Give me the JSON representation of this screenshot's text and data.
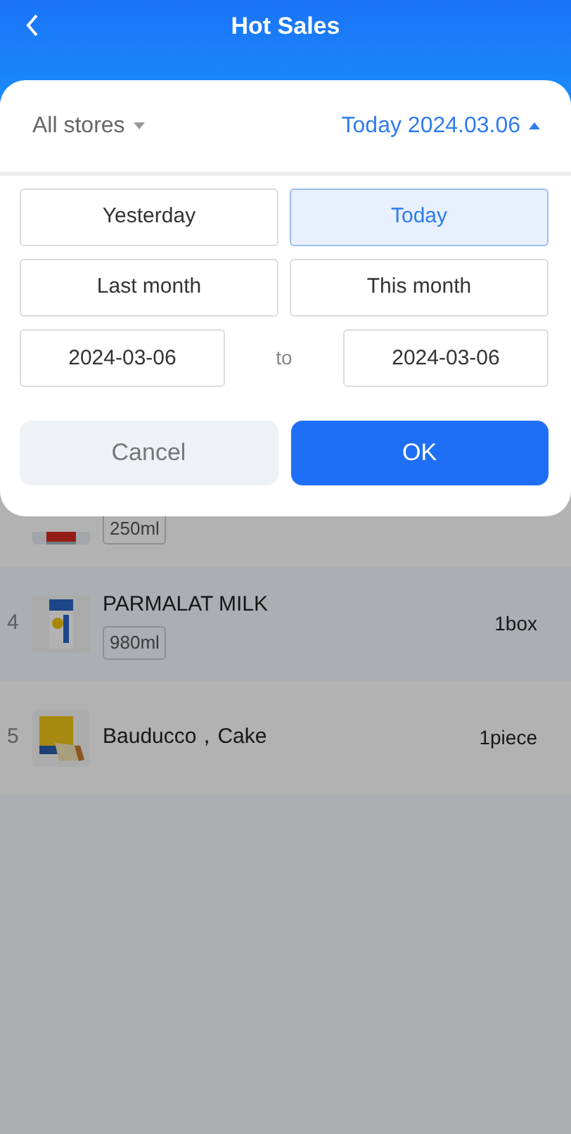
{
  "header": {
    "title": "Hot Sales"
  },
  "filter": {
    "store": {
      "label": "All stores",
      "expanded": false
    },
    "period": {
      "label": "Today",
      "date": "2024.03.06",
      "expanded": true
    }
  },
  "presets": [
    {
      "label": "Yesterday",
      "selected": false
    },
    {
      "label": "Today",
      "selected": true
    },
    {
      "label": "Last month",
      "selected": false
    },
    {
      "label": "This month",
      "selected": false
    }
  ],
  "range": {
    "start": "2024-03-06",
    "separator": "to",
    "end": "2024-03-06"
  },
  "buttons": [
    {
      "label": "Cancel",
      "kind": "secondary"
    },
    {
      "label": "OK",
      "kind": "primary"
    }
  ],
  "products": [
    {
      "tag": "250ml"
    },
    {
      "rank": "4",
      "name": "PARMALAT MILK",
      "tag": "980ml",
      "quantity": "1box"
    },
    {
      "rank": "5",
      "name": "Bauducco，Cake",
      "quantity": "1piece"
    }
  ]
}
